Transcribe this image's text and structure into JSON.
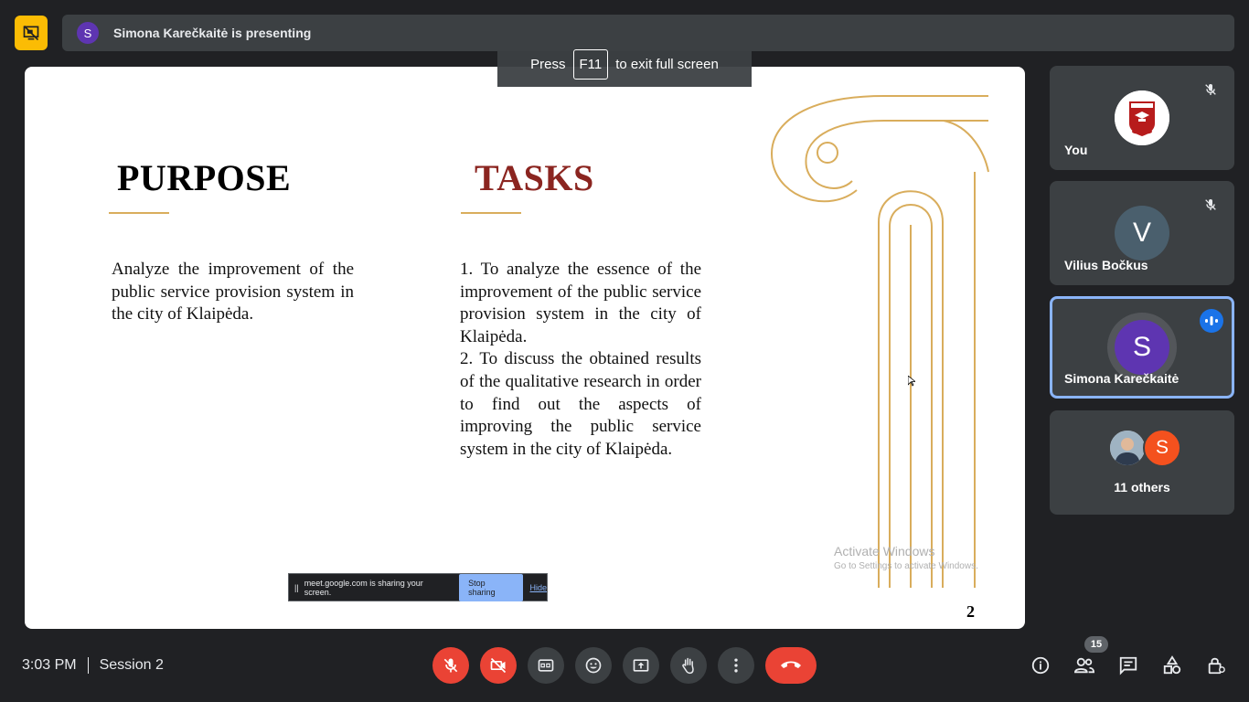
{
  "header": {
    "presenter_avatar_letter": "S",
    "presenting_text": "Simona Karečkaitė is presenting"
  },
  "fullscreen_toast": {
    "press": "Press",
    "key": "F11",
    "rest": "to exit full screen"
  },
  "slide": {
    "purpose_heading": "PURPOSE",
    "tasks_heading": "TASKS",
    "purpose_text": "Analyze the improvement of the public service provision system in the city of Klaipėda.",
    "tasks_text_1": "1. To analyze the essence of the improvement of the public service provision system in the city of Klaipėda.",
    "tasks_text_2": "2. To discuss the obtained results of the qualitative research in order to find out the aspects of improving the public service system in the city of Klaipėda.",
    "page_number": "2",
    "watermark_line1": "Activate Windows",
    "watermark_line2": "Go to Settings to activate Windows.",
    "tasks_color": "#8b2520",
    "accent_color": "#d9ad5c"
  },
  "share_banner": {
    "pause": "||",
    "message": "meet.google.com is sharing your screen.",
    "stop_label": "Stop sharing",
    "hide_label": "Hide"
  },
  "participants": {
    "you": {
      "name": "You",
      "avatar_icon": "school-logo-icon"
    },
    "vilius": {
      "name": "Vilius Bočkus",
      "letter": "V"
    },
    "simona": {
      "name": "Simona Karečkaitė",
      "letter": "S"
    },
    "others": {
      "letter": "S",
      "label": "11 others"
    }
  },
  "footer": {
    "time": "3:03 PM",
    "meeting_name": "Session 2",
    "people_count": "15",
    "accent_red": "#ea4335",
    "speaking_blue": "#1a73e8"
  }
}
